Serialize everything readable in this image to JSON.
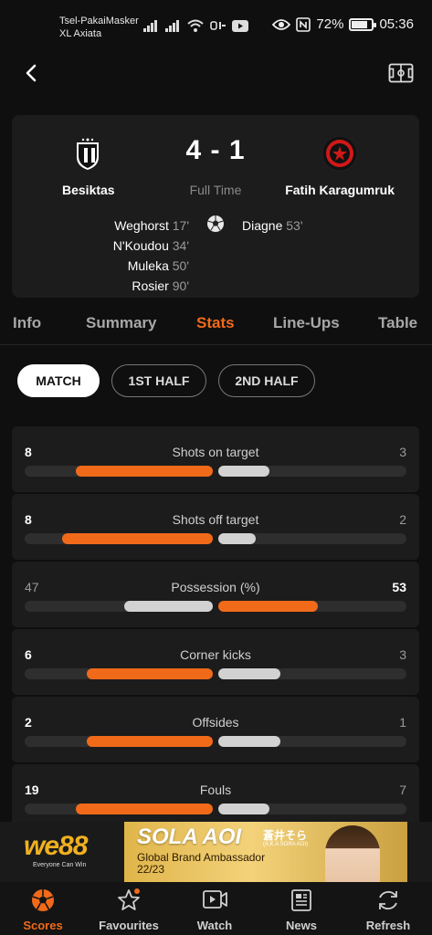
{
  "status_bar": {
    "carrier_line1": "Tsel-PakaiMasker",
    "carrier_line2": "XL Axiata",
    "battery": "72%",
    "time": "05:36"
  },
  "match": {
    "home_team": "Besiktas",
    "away_team": "Fatih Karagumruk",
    "score": "4 - 1",
    "status": "Full Time",
    "home_scorers": [
      {
        "name": "Weghorst",
        "minute": "17'"
      },
      {
        "name": "N'Koudou",
        "minute": "34'"
      },
      {
        "name": "Muleka",
        "minute": "50'"
      },
      {
        "name": "Rosier",
        "minute": "90'"
      }
    ],
    "away_scorers": [
      {
        "name": "Diagne",
        "minute": "53'"
      }
    ]
  },
  "tabs": [
    "Info",
    "Summary",
    "Stats",
    "Line-Ups",
    "Table"
  ],
  "active_tab": "Stats",
  "periods": [
    "MATCH",
    "1ST HALF",
    "2ND HALF"
  ],
  "active_period": "MATCH",
  "stats": [
    {
      "label": "Shots on target",
      "home": "8",
      "away": "3",
      "home_frac": 0.73,
      "away_frac": 0.27
    },
    {
      "label": "Shots off target",
      "home": "8",
      "away": "2",
      "home_frac": 0.8,
      "away_frac": 0.2
    },
    {
      "label": "Possession (%)",
      "home": "47",
      "away": "53",
      "home_frac": 0.47,
      "away_frac": 0.53
    },
    {
      "label": "Corner kicks",
      "home": "6",
      "away": "3",
      "home_frac": 0.67,
      "away_frac": 0.33
    },
    {
      "label": "Offsides",
      "home": "2",
      "away": "1",
      "home_frac": 0.67,
      "away_frac": 0.33
    },
    {
      "label": "Fouls",
      "home": "19",
      "away": "7",
      "home_frac": 0.73,
      "away_frac": 0.27
    }
  ],
  "ad": {
    "brand": "we88",
    "brand_tag": "Everyone Can Win",
    "headline": "SOLA AOI",
    "headline_jp": "蒼井そら",
    "headline_aka": "(A.K.A SORA AOI)",
    "sub_line1": "Global Brand Ambassador",
    "sub_line2": "22/23"
  },
  "bottom_nav": [
    {
      "label": "Scores",
      "icon": "soccer-ball-icon"
    },
    {
      "label": "Favourites",
      "icon": "star-icon"
    },
    {
      "label": "Watch",
      "icon": "video-play-icon"
    },
    {
      "label": "News",
      "icon": "newspaper-icon"
    },
    {
      "label": "Refresh",
      "icon": "refresh-icon"
    }
  ],
  "colors": {
    "accent": "#f06a1a",
    "background": "#0f0f0f",
    "card": "#1c1c1c",
    "bar_secondary": "#d2d2d2"
  }
}
